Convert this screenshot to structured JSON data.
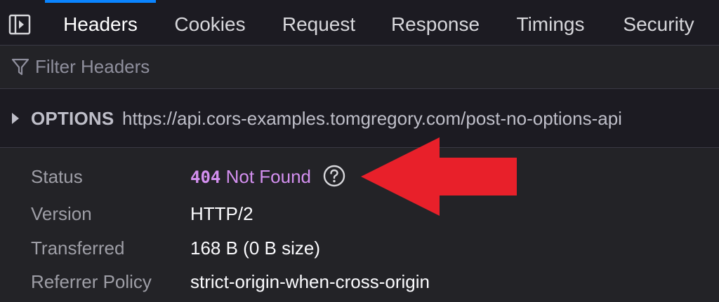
{
  "tabs": [
    {
      "label": "Headers",
      "selected": true
    },
    {
      "label": "Cookies",
      "selected": false
    },
    {
      "label": "Request",
      "selected": false
    },
    {
      "label": "Response",
      "selected": false
    },
    {
      "label": "Timings",
      "selected": false
    },
    {
      "label": "Security",
      "selected": false
    }
  ],
  "filter": {
    "placeholder": "Filter Headers",
    "value": ""
  },
  "request": {
    "method": "OPTIONS",
    "url": "https://api.cors-examples.tomgregory.com/post-no-options-api"
  },
  "headers": {
    "status": {
      "label": "Status",
      "code": "404",
      "text": "Not Found"
    },
    "version": {
      "label": "Version",
      "value": "HTTP/2"
    },
    "transferred": {
      "label": "Transferred",
      "value": "168 B (0 B size)"
    },
    "referrer_policy": {
      "label": "Referrer Policy",
      "value": "strict-origin-when-cross-origin"
    }
  },
  "colors": {
    "accent": "#0a84ff",
    "status_error": "#d38fef",
    "annotation_arrow": "#e8202a"
  },
  "icons": {
    "sidebar_toggle": "sidebar-toggle-icon",
    "filter": "filter-icon",
    "expand": "chevron-right-icon",
    "help": "help-icon"
  }
}
